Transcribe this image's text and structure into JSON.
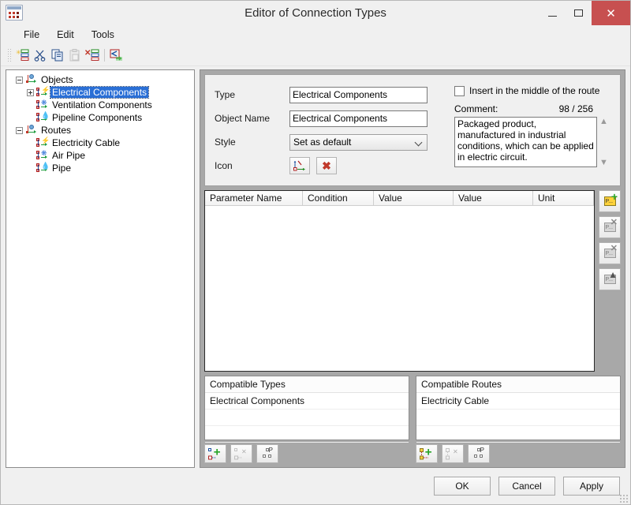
{
  "window": {
    "title": "Editor of Connection Types",
    "icon": "connection-types-icon",
    "minimize_label": "–",
    "maximize_label": "□",
    "close_label": "✕"
  },
  "menu": {
    "items": [
      {
        "label": "File"
      },
      {
        "label": "Edit"
      },
      {
        "label": "Tools"
      }
    ]
  },
  "toolbar": {
    "buttons": [
      {
        "name": "new-type-button",
        "icon": "new-list-icon",
        "enabled": true
      },
      {
        "name": "cut-button",
        "icon": "scissors-icon",
        "enabled": true
      },
      {
        "name": "copy-button",
        "icon": "copy-icon",
        "enabled": true
      },
      {
        "name": "paste-button",
        "icon": "paste-icon",
        "enabled": false
      },
      {
        "name": "delete-button",
        "icon": "delete-list-icon",
        "enabled": true
      },
      {
        "name": "export-button",
        "icon": "export-arrow-icon",
        "enabled": true
      }
    ]
  },
  "tree": {
    "nodes": [
      {
        "label": "Objects",
        "level": 0,
        "expander": "minus",
        "icon": "group-axis-icon",
        "selected": false
      },
      {
        "label": "Electrical Components",
        "level": 1,
        "expander": "plus",
        "icon": "connection-icon",
        "selected": true
      },
      {
        "label": "Ventilation Components",
        "level": 1,
        "expander": "none",
        "icon": "fan-icon",
        "selected": false
      },
      {
        "label": "Pipeline Components",
        "level": 1,
        "expander": "none",
        "icon": "drop-icon",
        "selected": false
      },
      {
        "label": "Routes",
        "level": 0,
        "expander": "minus",
        "icon": "group-axis-icon",
        "selected": false
      },
      {
        "label": "Electricity Cable",
        "level": 1,
        "expander": "none",
        "icon": "cable-icon",
        "selected": false
      },
      {
        "label": "Air Pipe",
        "level": 1,
        "expander": "none",
        "icon": "fan-icon",
        "selected": false
      },
      {
        "label": "Pipe",
        "level": 1,
        "expander": "none",
        "icon": "drop-icon",
        "selected": false
      }
    ]
  },
  "form": {
    "type_label": "Type",
    "type_value": "Electrical Components",
    "object_name_label": "Object Name",
    "object_name_value": "Electrical Components",
    "style_label": "Style",
    "style_value": "Set as default",
    "icon_label": "Icon",
    "icon_pick_name": "pick-icon-button",
    "icon_clear_name": "clear-icon-button",
    "insert_middle_label": "Insert in the middle of the route",
    "insert_middle_checked": false,
    "comment_label": "Comment:",
    "comment_counter": "98 / 256",
    "comment_value": "Packaged product, manufactured in industrial conditions, which can be applied in electric circuit."
  },
  "parameters": {
    "columns": [
      "Parameter Name",
      "Condition",
      "Value",
      "Value",
      "Unit"
    ],
    "rows": [],
    "buttons": [
      {
        "name": "add-parameter-button",
        "icon": "parameter-add-icon",
        "enabled": true
      },
      {
        "name": "delete-parameter-button",
        "icon": "parameter-delete-icon",
        "enabled": false
      },
      {
        "name": "delete-all-parameters-button",
        "icon": "parameter-delete-all-icon",
        "enabled": false
      },
      {
        "name": "move-parameter-up-button",
        "icon": "parameter-up-icon",
        "enabled": false
      }
    ]
  },
  "compatible_types": {
    "header": "Compatible Types",
    "items": [
      "Electrical Components"
    ],
    "buttons": [
      {
        "name": "add-compatible-type-button",
        "icon": "type-add-icon",
        "enabled": true
      },
      {
        "name": "remove-compatible-type-button",
        "icon": "type-remove-icon",
        "enabled": false
      },
      {
        "name": "compatible-type-properties-button",
        "icon": "type-tree-icon",
        "enabled": true
      }
    ]
  },
  "compatible_routes": {
    "header": "Compatible Routes",
    "items": [
      "Electricity Cable"
    ],
    "buttons": [
      {
        "name": "add-compatible-route-button",
        "icon": "route-add-icon",
        "enabled": true
      },
      {
        "name": "remove-compatible-route-button",
        "icon": "route-remove-icon",
        "enabled": false
      },
      {
        "name": "compatible-route-properties-button",
        "icon": "route-tree-icon",
        "enabled": true
      }
    ]
  },
  "footer": {
    "ok_label": "OK",
    "cancel_label": "Cancel",
    "apply_label": "Apply"
  },
  "colors": {
    "close_button": "#c75050",
    "selection": "#2a6fd6",
    "panel_gray": "#a8a8a8",
    "window_bg": "#f0f0f0"
  }
}
